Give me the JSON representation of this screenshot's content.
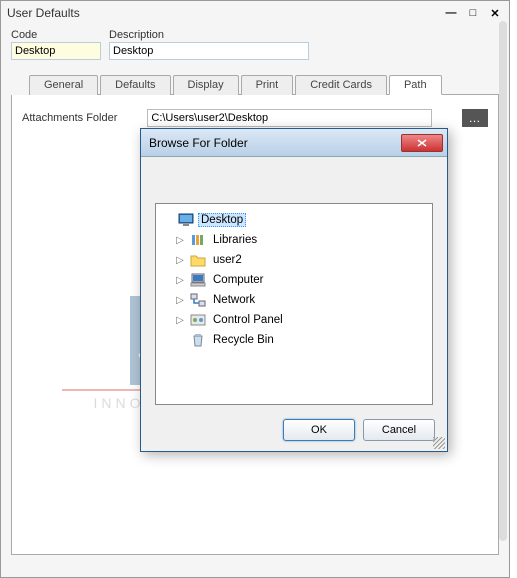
{
  "window": {
    "title": "User Defaults"
  },
  "fields": {
    "code_label": "Code",
    "code_value": "Desktop",
    "desc_label": "Description",
    "desc_value": "Desktop"
  },
  "tabs": {
    "general": "General",
    "defaults": "Defaults",
    "display": "Display",
    "print": "Print",
    "credit": "Credit Cards",
    "path": "Path"
  },
  "attachments": {
    "label": "Attachments Folder",
    "path_value": "C:\\Users\\user2\\Desktop"
  },
  "dialog": {
    "title": "Browse For Folder",
    "ok": "OK",
    "cancel": "Cancel",
    "tree": {
      "desktop": "Desktop",
      "libraries": "Libraries",
      "user2": "user2",
      "computer": "Computer",
      "network": "Network",
      "control_panel": "Control Panel",
      "recycle_bin": "Recycle Bin"
    }
  },
  "watermark": {
    "tagline": "INNOVATION • DESIGN • VALUE"
  }
}
